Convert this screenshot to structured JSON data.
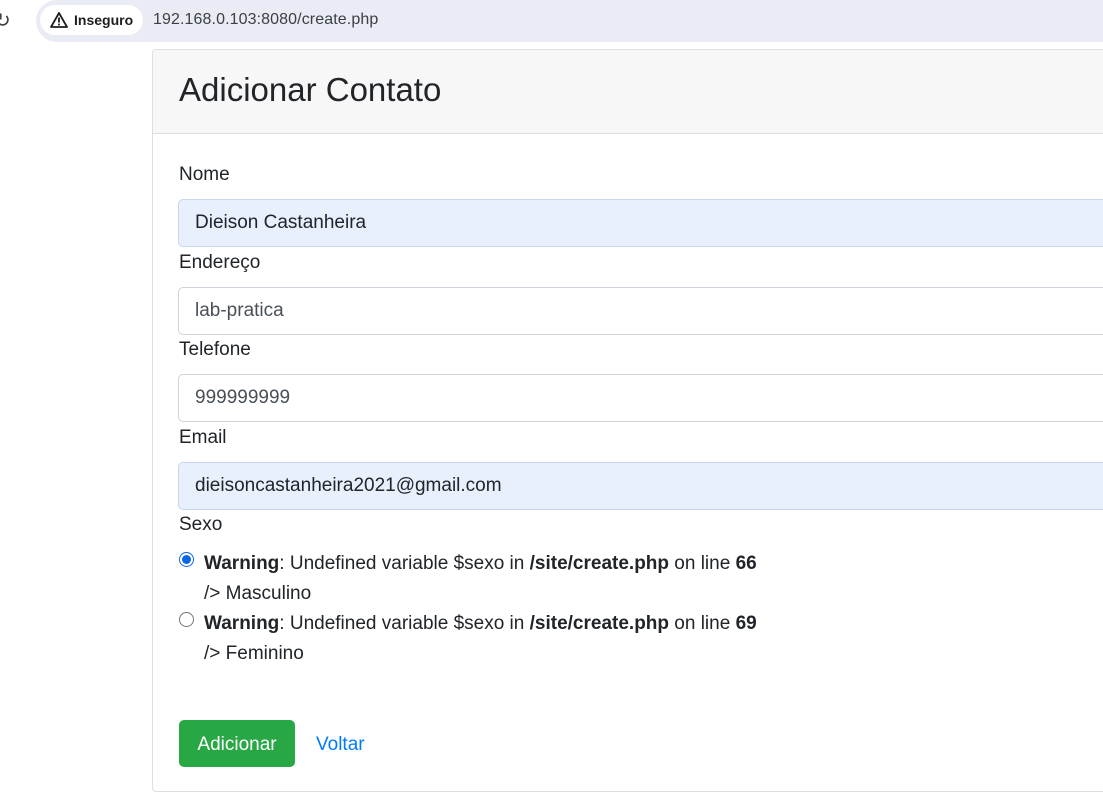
{
  "browser": {
    "security_label": "Inseguro",
    "url": "192.168.0.103:8080/create.php"
  },
  "page": {
    "title": "Adicionar Contato"
  },
  "form": {
    "nome": {
      "label": "Nome",
      "value": "Dieison Castanheira"
    },
    "endereco": {
      "label": "Endereço",
      "value": "lab-pratica"
    },
    "telefone": {
      "label": "Telefone",
      "value": "999999999"
    },
    "email": {
      "label": "Email",
      "value": "dieisoncastanheira2021@gmail.com"
    },
    "sexo": {
      "label": "Sexo",
      "options": [
        {
          "warning": "Warning",
          "message": ": Undefined variable $sexo in ",
          "file": "/site/create.php",
          "on_line": " on line ",
          "line": "66",
          "suffix": "/> Masculino",
          "checked": true
        },
        {
          "warning": "Warning",
          "message": ": Undefined variable $sexo in ",
          "file": "/site/create.php",
          "on_line": " on line ",
          "line": "69",
          "suffix": "/> Feminino",
          "checked": false
        }
      ]
    },
    "submit_label": "Adicionar",
    "back_label": "Voltar"
  },
  "colors": {
    "primary": "#007bff",
    "success": "#28a745",
    "autofill_bg": "#e8f0fe",
    "radio_checked": "#0b66e4"
  }
}
